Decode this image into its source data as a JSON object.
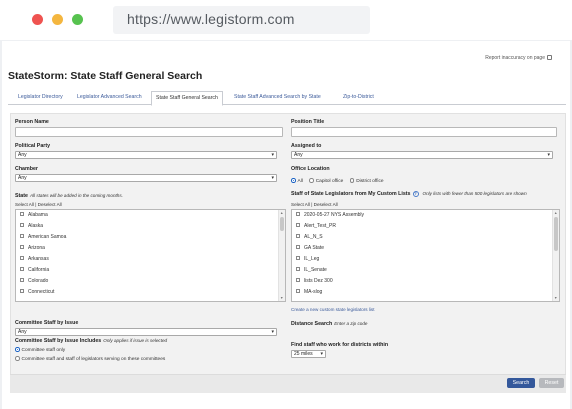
{
  "browser": {
    "url": "https://www.legistorm.com"
  },
  "report": {
    "label": "Report inaccuracy on page"
  },
  "page": {
    "title": "StateStorm: State Staff General Search"
  },
  "tabs": [
    {
      "label": "Legislator Directory"
    },
    {
      "label": "Legislator Advanced Search"
    },
    {
      "label": "State Staff General Search"
    },
    {
      "label": "State Staff Advanced Search by State"
    },
    {
      "label": "Zip-to-District"
    }
  ],
  "form": {
    "person_name": {
      "label": "Person Name",
      "value": ""
    },
    "position_title": {
      "label": "Position Title",
      "value": ""
    },
    "political_party": {
      "label": "Political Party",
      "value": "Any"
    },
    "assigned_to": {
      "label": "Assigned to",
      "value": "Any"
    },
    "chamber": {
      "label": "Chamber",
      "value": "Any"
    },
    "office_location": {
      "label": "Office Location",
      "options": [
        "All",
        "Capitol office",
        "District office"
      ],
      "selected": "All"
    },
    "state": {
      "label": "State",
      "note": "All states will be added in the coming months.",
      "select_all": "Select All",
      "separator": "|",
      "deselect_all": "Deselect All",
      "items": [
        "Alabama",
        "Alaska",
        "American Samoa",
        "Arizona",
        "Arkansas",
        "California",
        "Colorado",
        "Connecticut"
      ]
    },
    "custom_lists": {
      "label": "Staff of State Legislators from My Custom Lists",
      "help_icon": "?",
      "note": "Only lists with fewer than 500 legislators are shown",
      "select_all": "Select All",
      "separator": "|",
      "deselect_all": "Deselect All",
      "items": [
        "2020-05-27 NYS Assembly",
        "Alert_Test_PR",
        "AL_N_S",
        "GA State",
        "IL_Leg",
        "IL_Senate",
        "lists Dez 300",
        "MA-slog"
      ],
      "create_link": "Create a new custom state legislators list"
    },
    "committee_issue": {
      "label": "Committee Staff by Issue",
      "value": "Any"
    },
    "committee_includes": {
      "label": "Committee Staff by Issue Includes",
      "note": "Only applies if issue is selected",
      "options": [
        "Committee staff only",
        "Committee staff and staff of legislators serving on these committees"
      ],
      "selected": 0
    },
    "distance": {
      "label": "Distance Search",
      "note": "Enter a zip code"
    },
    "find_staff": {
      "label": "Find staff who work for districts within",
      "value": "25 miles"
    }
  },
  "buttons": {
    "search": "Search",
    "reset": "Reset"
  },
  "colors": {
    "accent": "#34589b",
    "link": "#3b5a9a",
    "panel": "#f2f2f2"
  }
}
